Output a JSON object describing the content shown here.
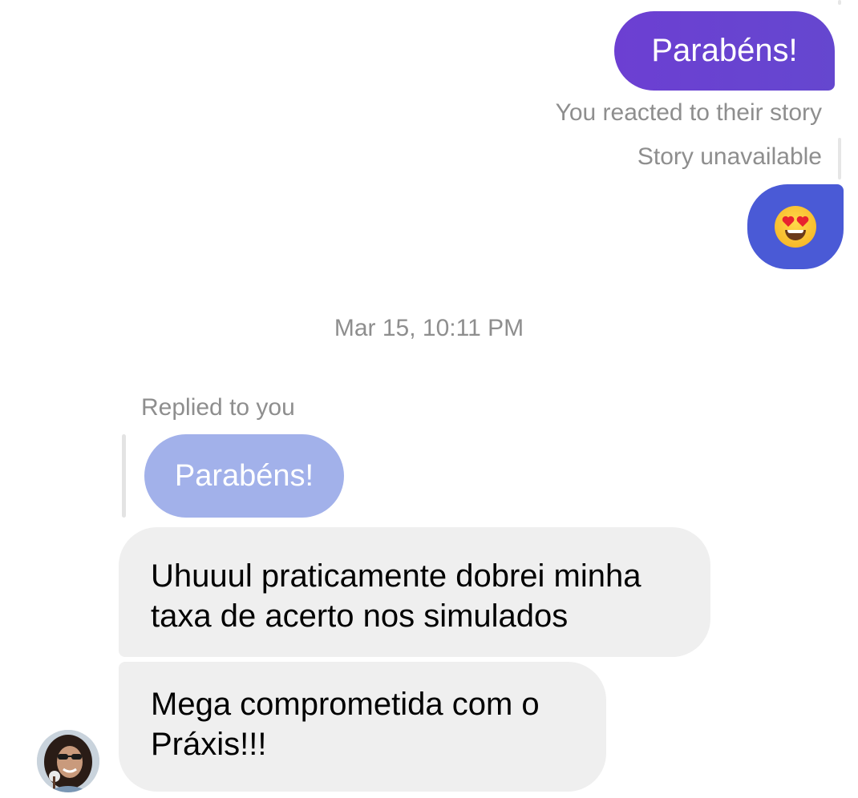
{
  "messages": {
    "sent_text": "Parabéns!",
    "reacted_label": "You reacted to their story",
    "story_unavailable": "Story unavailable",
    "reaction_emoji": "smiling-face-with-heart-eyes",
    "timestamp": "Mar 15, 10:11 PM",
    "replied_label": "Replied to you",
    "quoted_text": "Parabéns!",
    "received": [
      {
        "lines": [
          "Uhuuul praticamente dobrei minha",
          "taxa de acerto nos simulados"
        ]
      },
      {
        "lines": [
          "Mega comprometida com o",
          "Práxis!!!"
        ]
      }
    ]
  },
  "colors": {
    "sent_bubble": "#6547cf",
    "reaction_bubble": "#4a5ad6",
    "quoted_bubble": "#a2b1ea",
    "received_bubble": "#efefef",
    "meta_text": "#8e8e8e"
  }
}
